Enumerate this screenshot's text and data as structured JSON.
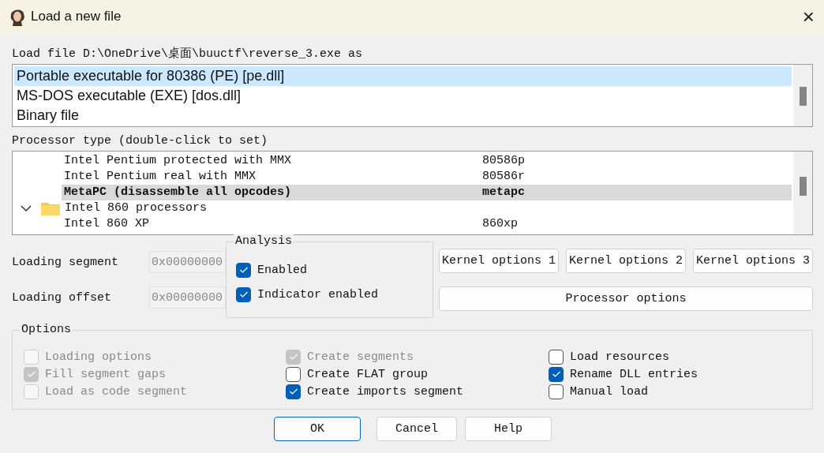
{
  "window": {
    "title": "Load a new file",
    "close": "×"
  },
  "load_label": "Load file D:\\OneDrive\\桌面\\buuctf\\reverse_3.exe as",
  "loaders": [
    {
      "label": "Portable executable for 80386 (PE) [pe.dll]",
      "selected": true
    },
    {
      "label": "MS-DOS executable (EXE) [dos.dll]",
      "selected": false
    },
    {
      "label": "Binary file",
      "selected": false
    }
  ],
  "processor_label": "Processor type (double-click to set)",
  "processors": [
    {
      "kind": "item",
      "name": "Intel Pentium protected with MMX",
      "code": "80586p",
      "selected": false
    },
    {
      "kind": "item",
      "name": "Intel Pentium real with MMX",
      "code": "80586r",
      "selected": false
    },
    {
      "kind": "item",
      "name": "MetaPC (disassemble all opcodes)",
      "code": "metapc",
      "selected": true
    },
    {
      "kind": "group",
      "name": "Intel 860 processors",
      "expanded": true,
      "children": [
        {
          "kind": "item",
          "name": "Intel 860 XP",
          "code": "860xp",
          "selected": false
        }
      ]
    }
  ],
  "fields": [
    {
      "label": "Loading segment",
      "value": "0x00000000",
      "disabled": true
    },
    {
      "label": "Loading offset",
      "value": "0x00000000",
      "disabled": true
    }
  ],
  "analysis": {
    "title": "Analysis",
    "options": [
      {
        "label": "Enabled",
        "checked": true,
        "disabled": false
      },
      {
        "label": "Indicator enabled",
        "checked": true,
        "disabled": false
      }
    ]
  },
  "kernel_buttons": [
    "Kernel options 1",
    "Kernel options 2",
    "Kernel options 3"
  ],
  "processor_button": "Processor options",
  "options": {
    "title": "Options",
    "items": [
      {
        "label": "Loading options",
        "checked": false,
        "disabled": true
      },
      {
        "label": "Fill segment gaps",
        "checked": true,
        "disabled": true
      },
      {
        "label": "Load as code segment",
        "checked": false,
        "disabled": true
      },
      {
        "label": "Create segments",
        "checked": true,
        "disabled": true
      },
      {
        "label": "Create FLAT group",
        "checked": false,
        "disabled": false
      },
      {
        "label": "Create imports segment",
        "checked": true,
        "disabled": false
      },
      {
        "label": "Load resources",
        "checked": false,
        "disabled": false
      },
      {
        "label": "Rename DLL entries",
        "checked": true,
        "disabled": false
      },
      {
        "label": "Manual load",
        "checked": false,
        "disabled": false
      }
    ]
  },
  "buttons": [
    {
      "label": "OK",
      "default": true
    },
    {
      "label": "Cancel",
      "default": false
    },
    {
      "label": "Help",
      "default": false
    }
  ]
}
